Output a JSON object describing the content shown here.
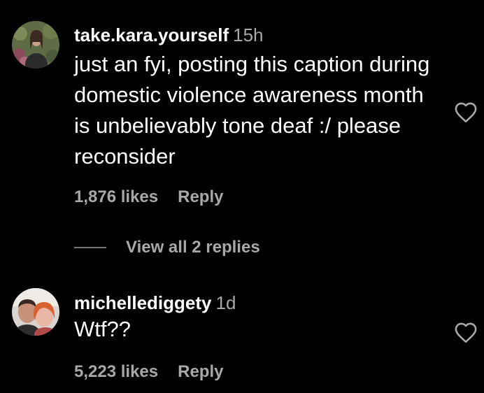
{
  "comments": [
    {
      "username": "take.kara.yourself",
      "timestamp": "15h",
      "text": "just an fyi, posting this caption during domestic violence awareness month is unbelievably tone deaf :/ please reconsider",
      "likes": "1,876 likes",
      "reply_label": "Reply",
      "avatar_icon": "avatar-photo-woman-outdoors",
      "like_icon": "heart-outline-icon"
    },
    {
      "username": "michellediggety",
      "timestamp": "1d",
      "text": "Wtf??",
      "likes": "5,223 likes",
      "reply_label": "Reply",
      "avatar_icon": "avatar-photo-couple",
      "like_icon": "heart-outline-icon"
    }
  ],
  "replies_toggle": {
    "label": "View all 2 replies"
  },
  "colors": {
    "background": "#000000",
    "primary_text": "#ffffff",
    "secondary_text": "#a8a8a8",
    "divider": "#737373"
  }
}
